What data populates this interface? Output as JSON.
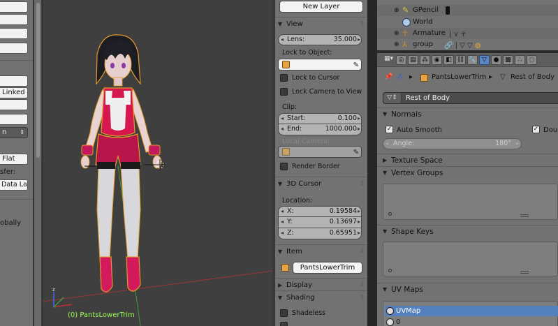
{
  "left_panel": {
    "buttons": [
      "",
      "",
      "",
      "Linked",
      "",
      "",
      "",
      "Flat",
      "Data La"
    ],
    "labels": [
      "sfer:",
      "obally"
    ]
  },
  "viewport": {
    "object_label": "(0) PantsLowerTrim"
  },
  "n_panel": {
    "new_layer_button": "New Layer",
    "view": {
      "header": "View",
      "lens_label": "Lens:",
      "lens_value": "35.000",
      "lock_to_object_label": "Lock to Object:",
      "lock_to_cursor": "Lock to Cursor",
      "lock_camera_to_view": "Lock Camera to View",
      "clip_label": "Clip:",
      "clip_start_label": "Start:",
      "clip_start_value": "0.100",
      "clip_end_label": "End:",
      "clip_end_value": "1000.000",
      "local_camera_label": "Local Camera:",
      "render_border": "Render Border"
    },
    "cursor": {
      "header": "3D Cursor",
      "location_label": "Location:",
      "x_label": "X:",
      "x_value": "0.19584",
      "y_label": "Y:",
      "y_value": "0.13697",
      "z_label": "Z:",
      "z_value": "0.65951"
    },
    "item": {
      "header": "Item",
      "name": "PantsLowerTrim"
    },
    "display_header": "Display",
    "shading": {
      "header": "Shading",
      "shadeless": "Shadeless"
    }
  },
  "outliner": {
    "rows": [
      {
        "label": "GPencil"
      },
      {
        "label": "World"
      },
      {
        "label": "Armature"
      },
      {
        "label": "group"
      }
    ]
  },
  "properties": {
    "breadcrumb_object": "PantsLowerTrim",
    "breadcrumb_mesh": "Rest of Body",
    "mesh_datablock": "Rest of Body",
    "normals": {
      "header": "Normals",
      "auto_smooth": "Auto Smooth",
      "double_sided": "Doub",
      "angle_label": "Angle:",
      "angle_value": "180°"
    },
    "texture_space_header": "Texture Space",
    "vertex_groups_header": "Vertex Groups",
    "shape_keys_header": "Shape Keys",
    "uv_maps": {
      "header": "UV Maps",
      "items": [
        "UVMap",
        "0"
      ]
    }
  },
  "colors": {
    "accent_selected": "#5580be",
    "panel_bg": "#727272",
    "viewport_bg": "#3f3f3f",
    "object_label": "#9cff52"
  }
}
